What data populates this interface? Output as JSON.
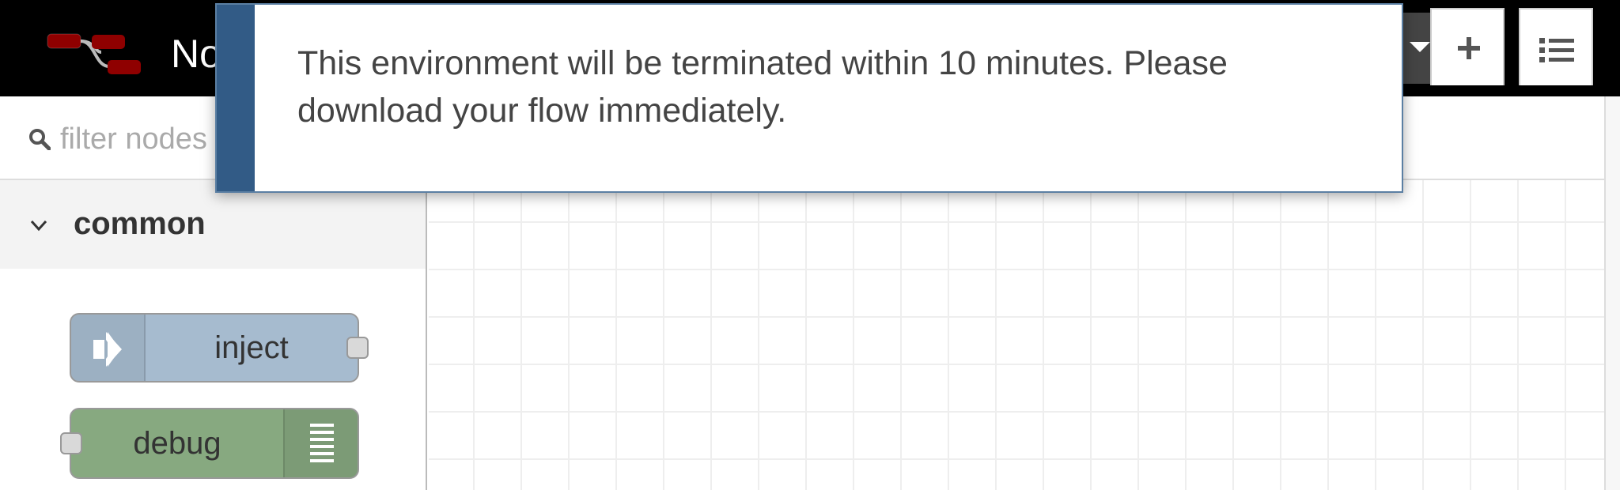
{
  "header": {
    "title": "No",
    "logo_icon": "node-red-flow-icon",
    "deploy_dropdown_icon": "caret-down-icon",
    "menu_icon": "hamburger-menu-icon",
    "colors": {
      "background": "#000000",
      "text": "#ffffff"
    }
  },
  "palette": {
    "search": {
      "placeholder": "filter nodes",
      "value": ""
    },
    "categories": [
      {
        "label": "common",
        "expanded": true,
        "nodes": [
          {
            "label": "inject",
            "icon": "arrow-in-icon",
            "color": "#a6bbcf"
          },
          {
            "label": "debug",
            "icon": "debug-list-icon",
            "color": "#87a980"
          }
        ]
      }
    ]
  },
  "workspace": {
    "tab_actions": [
      {
        "name": "add-flow",
        "icon": "plus-icon"
      },
      {
        "name": "list-flows",
        "icon": "list-icon"
      }
    ]
  },
  "notification": {
    "message": "This environment will be terminated within 10 minutes. Please download your flow immediately.",
    "accent_color": "#325b86"
  }
}
